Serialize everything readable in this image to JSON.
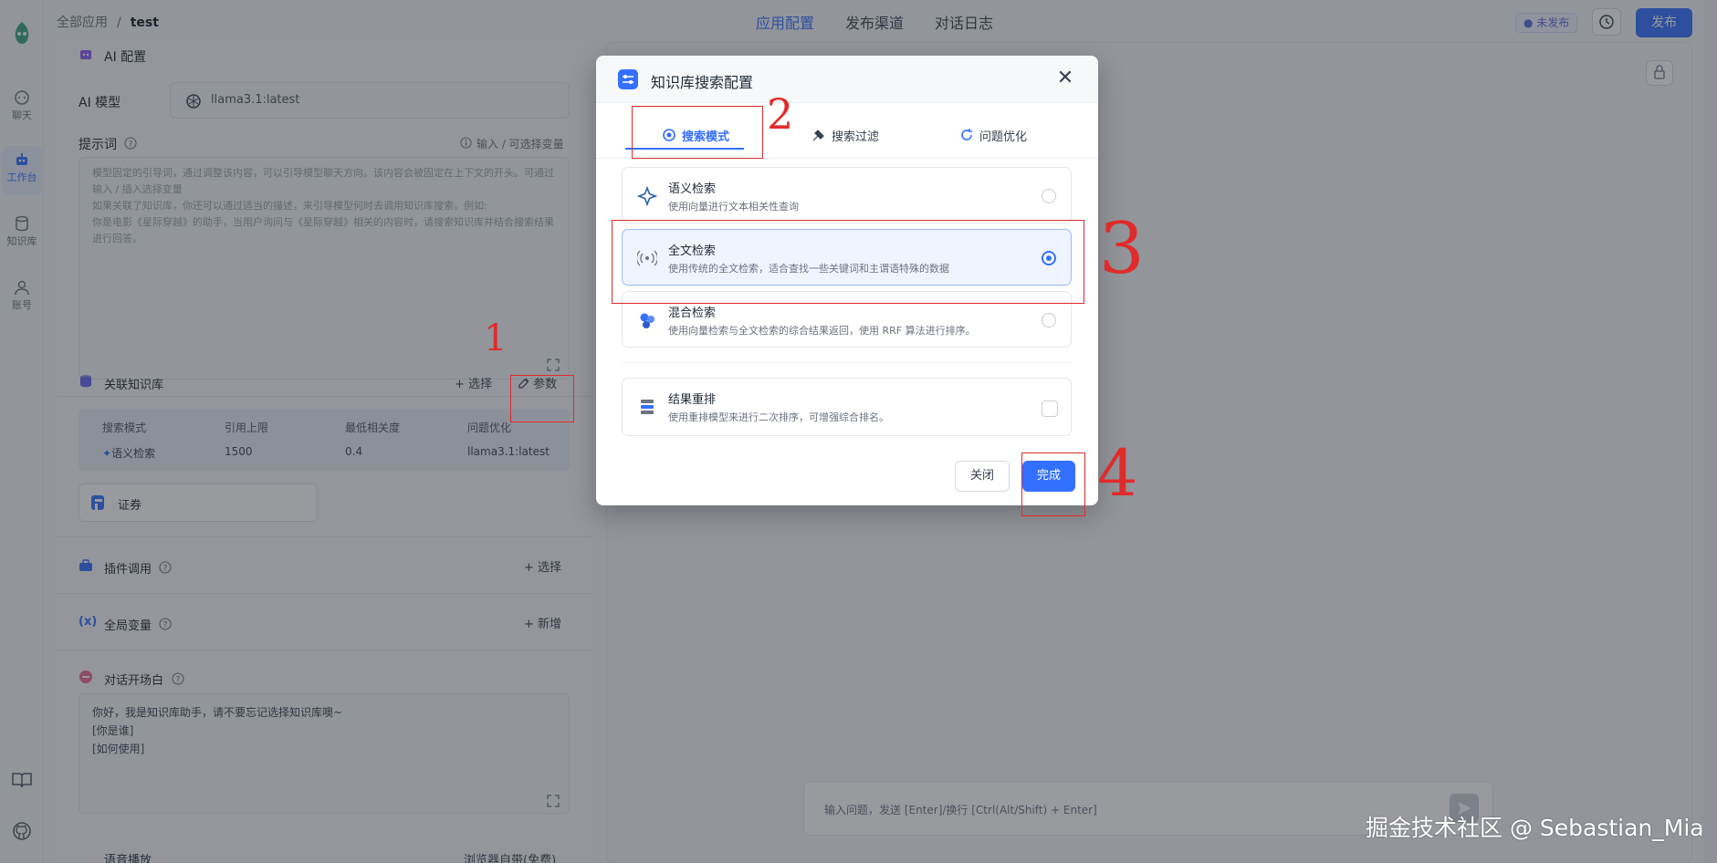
{
  "rail": {
    "items": [
      {
        "label": "聊天"
      },
      {
        "label": "工作台"
      },
      {
        "label": "知识库"
      },
      {
        "label": "账号"
      }
    ]
  },
  "header": {
    "breadcrumb_root": "全部应用",
    "breadcrumb_sep": "/",
    "breadcrumb_current": "test",
    "tabs": [
      "应用配置",
      "发布渠道",
      "对话日志"
    ],
    "active_tab": "应用配置",
    "status": "● 未发布",
    "publish": "发布"
  },
  "panel": {
    "ai_config_title": "AI 配置",
    "model_label": "AI 模型",
    "model_value": "llama3.1:latest",
    "prompt_label": "提示词",
    "prompt_var_hint": "输入 / 可选择变量",
    "prompt_placeholder": "模型固定的引导词，通过调整该内容，可以引导模型聊天方向。该内容会被固定在上下文的开头。可通过输入 / 插入选择变量\n如果关联了知识库，你还可以通过适当的描述，来引导模型何时去调用知识库搜索。例如:\n你是电影《星际穿越》的助手，当用户询问与《星际穿越》相关的内容时，请搜索知识库并结合搜索结果进行回答。",
    "kb_title": "关联知识库",
    "kb_select": "+ 选择",
    "kb_params": "参数",
    "kb_headers": [
      "搜索模式",
      "引用上限",
      "最低相关度",
      "问题优化"
    ],
    "kb_values": [
      "语义检索",
      "1500",
      "0.4",
      "llama3.1:latest"
    ],
    "kb_item": "证券",
    "plugin_title": "插件调用",
    "plugin_select": "+ 选择",
    "vars_title": "全局变量",
    "vars_add": "+ 新增",
    "opening_title": "对话开场白",
    "opening_lines": [
      "你好，我是知识库助手，请不要忘记选择知识库噢~",
      "[你是谁]",
      "[如何使用]"
    ],
    "tts_title": "语音播放",
    "tts_value": "浏览器自带(免费)"
  },
  "preview": {
    "input_placeholder": "输入问题，发送 [Enter]/换行 [Ctrl(Alt/Shift) + Enter]",
    "watermark": "掘金技术社区 @ Sebastian_Mia"
  },
  "modal": {
    "title": "知识库搜索配置",
    "tabs": [
      "搜索模式",
      "搜索过滤",
      "问题优化"
    ],
    "active_tab": "搜索模式",
    "options": [
      {
        "title": "语义检索",
        "desc": "使用向量进行文本相关性查询",
        "selected": false
      },
      {
        "title": "全文检索",
        "desc": "使用传统的全文检索，适合查找一些关键词和主谓语特殊的数据",
        "selected": true
      },
      {
        "title": "混合检索",
        "desc": "使用向量检索与全文检索的综合结果返回，使用 RRF 算法进行排序。",
        "selected": false
      }
    ],
    "rerank_title": "结果重排",
    "rerank_desc": "使用重排模型来进行二次排序，可增强综合排名。",
    "rerank_checked": false,
    "close_btn": "关闭",
    "done_btn": "完成"
  },
  "annotations": [
    "1",
    "2",
    "3",
    "4"
  ],
  "colors": {
    "accent": "#3370ff",
    "annotation": "#e02b2b"
  }
}
